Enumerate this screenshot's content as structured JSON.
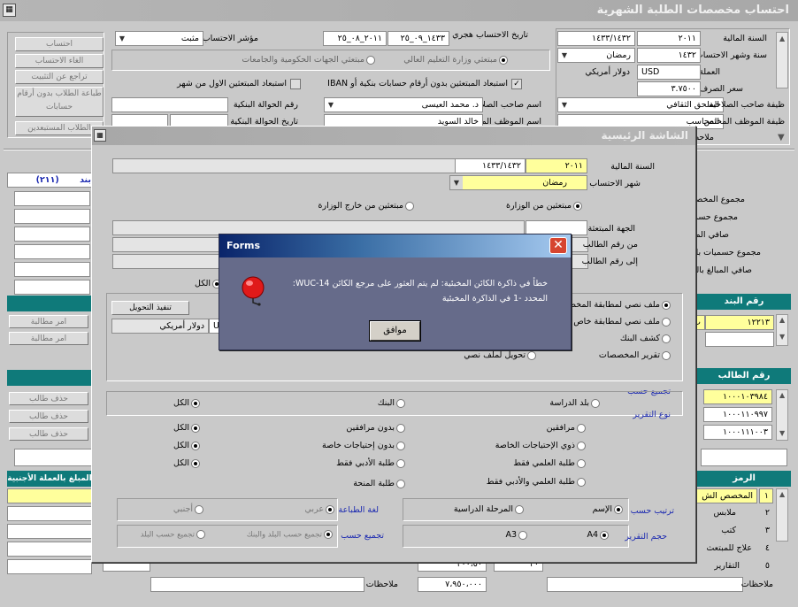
{
  "main_window": {
    "title": "احتساب مخصصات الطلبة الشهرية",
    "fiscal_year_label": "السنة المالية",
    "fiscal_year_value": "٢٠١١",
    "fiscal_year_hijri": "١٤٣٣/١٤٣٢",
    "year_month_label": "سنة وشهر الاحتساب",
    "year_month_year": "١٤٣٢",
    "year_month_month": "رمضان",
    "currency_label": "العملة",
    "currency_code": "USD",
    "currency_name": "دولار أمريكي",
    "exchange_rate_label": "سعر الصرف",
    "exchange_rate_value": "٣.٧٥٠٠",
    "hijri_date_label": "تاريخ الاحتساب هجري",
    "hijri_date_value": "١٤٣٣_٠٩_٢٥",
    "gregorian_date_value": "٢٠١١_٠٨_٢٥",
    "indicator_label": "مؤشر الاحتساب",
    "indicator_value": "مثبت",
    "radio_scholars_ministry": "مبتعثي وزارة التعليم العالي",
    "radio_scholars_govt": "مبتعثي الجهات الحكومية والجامعات",
    "check_excl_no_iban": "استبعاد المبتعثين بدون أرقام حسابات بنكية أو IBAN",
    "check_excl_first_month": "استبعاد المبتعثين الاول من شهر",
    "authority_job_label": "ظيفة صاحب الصلاحية",
    "authority_job_value": "الملحق الثقافي",
    "authority_name_label": "اسم صاحب الصلاحية",
    "authority_name_value": "د. محمد العيسى",
    "employee_job_label": "ظيفة الموظف المختص",
    "employee_job_value": "المحاسب",
    "employee_name_label": "اسم الموظف المختص",
    "employee_name_value": "خالد السويد",
    "transfer_no_label": "رقم الحوالة البنكية",
    "transfer_date_label": "تاريخ الحوالة البنكية",
    "notes_label": "ملاحظات",
    "buttons": {
      "calculate": "احتساب",
      "cancel_calc": "الغاء الاحتساب",
      "undo_confirm": "تراجع عن التثبيت",
      "print_no_account": "طباعة الطلاب بدون أرقام حسابات",
      "excluded_students": "الطلاب المستبعدين"
    },
    "item_label": "بند",
    "item_value": "(٢١١)",
    "left_side_buttons": [
      "امر مطالبة",
      "امر مطالبة"
    ],
    "left_delete_buttons": [
      "حذف طالب",
      "حذف طالب",
      "حذف طالب"
    ],
    "totals_labels": [
      "مجموع المخصصا",
      "مجموع حسميا",
      "صافي المبال",
      "مجموع حسميات بالعم",
      "صافي المبالغ بالعمل"
    ],
    "item_no_header": "رقم البند",
    "item_no_value": "١٢٢١٣",
    "student_no_header": "رقم الطالب",
    "student_numbers": [
      "١٠٠٠١٠٣٩٨٤",
      "١٠٠٠١١٠٩٩٧",
      "١٠٠٠١١١٠٠٣"
    ],
    "code_header": "الرمز",
    "bottom_rows": [
      {
        "num": "١",
        "label": "المخصص الش"
      },
      {
        "num": "٢",
        "label": "ملابس"
      },
      {
        "num": "٣",
        "label": "كتب"
      },
      {
        "num": "٤",
        "label": "علاج للمبتعث"
      },
      {
        "num": "٥",
        "label": "التقارير"
      }
    ],
    "foreign_amount_header": "المبلغ بالعملة الأجنبية",
    "bottom_notes_label": "ملاحظات",
    "bottom_total_value": "٧،٩٥٠،٠٠٠",
    "bottom_values": [
      "٢٠",
      "٢٠٠،٥٠"
    ]
  },
  "sub_window": {
    "title": "الشاشة الرئيسية",
    "fiscal_year_label": "السنة المالية",
    "fiscal_year_value": "٢٠١١",
    "fiscal_year_hijri": "١٤٣٣/١٤٣٢",
    "month_label": "شهر الاحتساب",
    "month_value": "رمضان",
    "radio_in_ministry": "مبتعثين من الوزارة",
    "radio_out_ministry": "مبتعثين من خارج الوزارة",
    "sponsor_label": "الجهة المبتعثة",
    "from_student_label": "من رقم الطالب",
    "to_student_label": "إلى رقم الطالب",
    "all_label": "الكل",
    "report_options": [
      "ملف نصي لمطابقة المخصصات",
      "ملف نصي لمطابقة خاص ب",
      "كشف البنك",
      "تقرير المخصصات"
    ],
    "text_transfer_label": "تحويل لملف نصي",
    "execute_transfer_button": "تنفيذ التحويل",
    "currency_code": "US",
    "currency_name": "دولار أمريكي",
    "group_by_label": "تجميع حسب",
    "group_by_options": [
      "بلد الدراسة",
      "البنك",
      "الكل"
    ],
    "report_type_label": "نوع التقرير",
    "report_type_rows": [
      [
        "مرافقين",
        "بدون مرافقين",
        "الكل"
      ],
      [
        "ذوي الإحتياجات الخاصة",
        "بدون إحتياجات خاصة",
        "الكل"
      ],
      [
        "طلبة العلمي فقط",
        "طلبة الأدبي فقط",
        "الكل"
      ],
      [
        "طلبة العلمي والأدبي فقط",
        "طلبة المنحة",
        ""
      ]
    ],
    "sort_by_label": "ترتيب حسب",
    "sort_options": [
      "الإسم",
      "المرحلة الدراسية"
    ],
    "print_lang_label": "لغة الطباعة",
    "print_lang_options": [
      "عربي",
      "أجنبي"
    ],
    "report_size_label": "حجم التقرير",
    "report_size_options": [
      "A4",
      "A3"
    ],
    "group_by2_label": "تجميع حسب",
    "group_by2_options": [
      "تجميع حسب البلد والبنك",
      "تجميع حسب البلد"
    ]
  },
  "dialog": {
    "title": "Forms",
    "message_line1": "خطأ في ذاكرة الكائن المخبئية: لم يتم العثور على مرجع الكائن WUC-14:",
    "message_line2": "المحدد -1 في الذاكرة المخبئية",
    "ok_button": "موافق"
  },
  "colors": {
    "title_gradient_start": "#0a246a",
    "title_gradient_end": "#a6caf0",
    "inactive_title": "#9a9a9a",
    "dialog_body": "#666b8a",
    "highlight_yellow": "#ffff9c",
    "teal_header": "#0f7a7a",
    "close_red": "#d64530"
  }
}
